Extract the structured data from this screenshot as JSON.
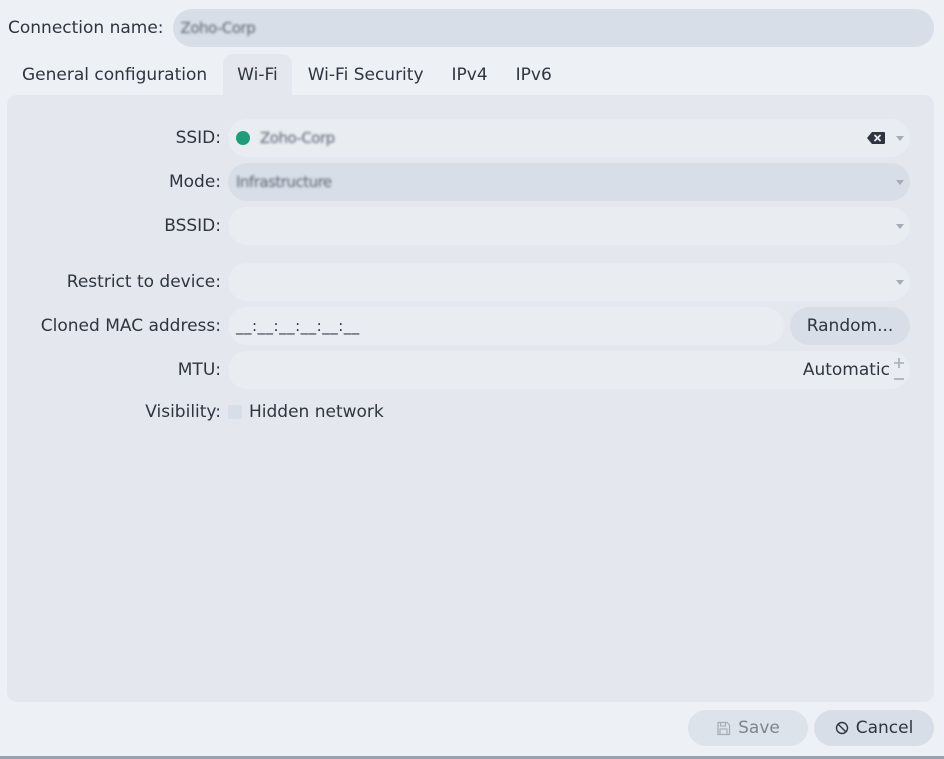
{
  "connection": {
    "label": "Connection name:",
    "value": "Zoho-Corp"
  },
  "tabs": [
    {
      "label": "General configuration",
      "active": false
    },
    {
      "label": "Wi-Fi",
      "active": true
    },
    {
      "label": "Wi-Fi Security",
      "active": false
    },
    {
      "label": "IPv4",
      "active": false
    },
    {
      "label": "IPv6",
      "active": false
    }
  ],
  "wifi": {
    "ssid": {
      "label": "SSID:",
      "value": "Zoho-Corp",
      "icon": "wifi-network-dot-icon",
      "dot_color": "#1f9d7a"
    },
    "mode": {
      "label": "Mode:",
      "value": "Infrastructure"
    },
    "bssid": {
      "label": "BSSID:",
      "value": ""
    },
    "restrict": {
      "label": "Restrict to device:",
      "value": ""
    },
    "mac": {
      "label": "Cloned MAC address:",
      "value": "__:__:__:__:__:__",
      "random_label": "Random..."
    },
    "mtu": {
      "label": "MTU:",
      "value": "Automatic"
    },
    "visibility": {
      "label": "Visibility:",
      "checkbox_label": "Hidden network",
      "checked": false
    }
  },
  "footer": {
    "save_label": "Save",
    "cancel_label": "Cancel"
  }
}
